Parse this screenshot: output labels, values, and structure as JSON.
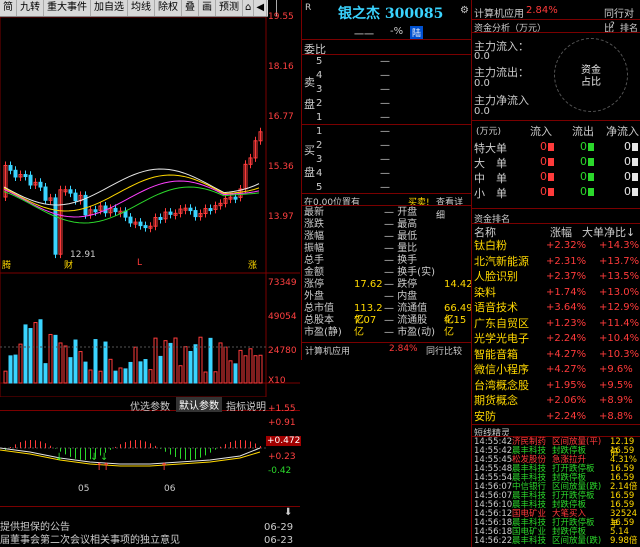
{
  "toolbar": {
    "items": [
      "简",
      "九转",
      "重大事件",
      "加自选",
      "均线",
      "除权",
      "叠",
      "画",
      "预测"
    ]
  },
  "price_axis": [
    "19.55",
    "18.16",
    "16.77",
    "15.36",
    "13.97"
  ],
  "chart": {
    "low_label": "12.91",
    "markers": [
      "腾",
      "财",
      "L",
      "涨"
    ]
  },
  "vol_axis": [
    "73349",
    "49054",
    "24780",
    "X10"
  ],
  "indicator": {
    "buttons": [
      "优选参数",
      "默认参数",
      "指标说明"
    ],
    "axis": [
      "+1.55",
      "+0.91",
      "+0.472",
      "+0.23",
      "-0.42"
    ],
    "months": [
      "05",
      "06"
    ]
  },
  "quote": {
    "code_prefix": "R",
    "name": "银之杰",
    "code": "300085",
    "dash": "一一",
    "pct_label": "-%",
    "flag": "陆",
    "webi_label": "委比",
    "sell_label": [
      "卖",
      "盘"
    ],
    "buy_label": [
      "买",
      "盘"
    ],
    "sell_rows": [
      "5",
      "4",
      "3",
      "2",
      "1"
    ],
    "buy_rows": [
      "1",
      "2",
      "3",
      "4",
      "5"
    ],
    "dash_val": "—",
    "pos_line": "在0.00位置有",
    "buy_link": "买卖!",
    "detail_link": "查看详细",
    "stats_left": [
      [
        "最新",
        ""
      ],
      [
        "涨跌",
        ""
      ],
      [
        "涨幅",
        ""
      ],
      [
        "振幅",
        ""
      ],
      [
        "总手",
        ""
      ],
      [
        "金额",
        ""
      ],
      [
        "涨停",
        "17.62"
      ],
      [
        "外盘",
        ""
      ],
      [
        "总市值",
        "113.2亿"
      ],
      [
        "总股本",
        "7.07亿"
      ],
      [
        "市盈(静)",
        ""
      ]
    ],
    "stats_right": [
      [
        "开盘",
        ""
      ],
      [
        "最高",
        ""
      ],
      [
        "最低",
        ""
      ],
      [
        "量比",
        ""
      ],
      [
        "换手",
        ""
      ],
      [
        "换手(实)",
        ""
      ],
      [
        "跌停",
        "14.42"
      ],
      [
        "内盘",
        ""
      ],
      [
        "流通值",
        "66.49亿"
      ],
      [
        "流通股",
        "4.15亿"
      ],
      [
        "市盈(动)",
        ""
      ]
    ],
    "sector_name": "计算机应用",
    "sector_pct": "2.84%",
    "sector_cmp": "同行比较"
  },
  "right": {
    "sector": "计算机应用",
    "sector_pct": "2.84%",
    "sector_cmp": "同行对比",
    "fund_title": "资金分析（万元）",
    "rank": "排名",
    "fund_rows": [
      [
        "主力流入：",
        "0.0"
      ],
      [
        "主力流出：",
        "0.0"
      ],
      [
        "主力净流入",
        ""
      ]
    ],
    "fund_net": "0.0",
    "pie_label": [
      "资金",
      "占比"
    ],
    "flow_header": [
      "(万元)",
      "流入",
      "流出",
      "净流入"
    ],
    "flow_rows": [
      [
        "特大单",
        "0",
        "0",
        "0"
      ],
      [
        "大　单",
        "0",
        "0",
        "0"
      ],
      [
        "中　单",
        "0",
        "0",
        "0"
      ],
      [
        "小　单",
        "0",
        "0",
        "0"
      ]
    ],
    "sector_title": "资金排名",
    "sector_cols": [
      "名称",
      "涨幅",
      "大单净比"
    ],
    "sectors": [
      [
        "钛白粉",
        "+2.32%",
        "+14.3%"
      ],
      [
        "北汽新能源",
        "+2.31%",
        "+13.7%"
      ],
      [
        "人脸识别",
        "+2.37%",
        "+13.5%"
      ],
      [
        "染料",
        "+1.74%",
        "+13.0%"
      ],
      [
        "语音技术",
        "+3.64%",
        "+12.9%"
      ],
      [
        "广东自贸区",
        "+1.23%",
        "+11.4%"
      ],
      [
        "光学光电子",
        "+2.24%",
        "+10.4%"
      ],
      [
        "智能音箱",
        "+4.27%",
        "+10.3%"
      ],
      [
        "微信小程序",
        "+4.27%",
        "+9.6%"
      ],
      [
        "台湾概念股",
        "+1.95%",
        "+9.5%"
      ],
      [
        "期货概念",
        "+2.06%",
        "+8.9%"
      ],
      [
        "安防",
        "+2.24%",
        "+8.8%"
      ]
    ],
    "elf_title": "短线精灵",
    "elf": [
      [
        "14:55:42",
        "济民制药",
        "区间放量(平)",
        "12.19倍"
      ],
      [
        "14:55:42",
        "晨丰科技",
        "封跌停板",
        "16.59"
      ],
      [
        "14:55:45",
        "松发股份",
        "急涨拉升",
        "4.31%"
      ],
      [
        "14:55:48",
        "晨丰科技",
        "打开跌停板",
        "16.59"
      ],
      [
        "14:55:54",
        "晨丰科技",
        "封跌停板",
        "16.59"
      ],
      [
        "14:56:07",
        "中信银行",
        "区间放量(跌)",
        "2.14倍"
      ],
      [
        "14:56:07",
        "晨丰科技",
        "打开跌停板",
        "16.59"
      ],
      [
        "14:56:10",
        "晨丰科技",
        "封跌停板",
        "16.59"
      ],
      [
        "14:56:12",
        "国电矿业",
        "大笔买入",
        "32524手"
      ],
      [
        "14:56:18",
        "晨丰科技",
        "打开跌停板",
        "16.59"
      ],
      [
        "14:56:18",
        "国电矿业",
        "封跌停板",
        "5.14"
      ],
      [
        "14:56:22",
        "晨丰科技",
        "区间放量(跌)",
        "9.98倍"
      ]
    ]
  },
  "news": [
    [
      "提供担保的公告",
      "06-29"
    ],
    [
      "届董事会第二次会议相关事项的独立意见",
      "06-23"
    ],
    [
      "",
      "06-23"
    ]
  ],
  "colors": {
    "up": "#ff3b3b",
    "down": "#2bd82b",
    "accent": "#ffd800"
  }
}
